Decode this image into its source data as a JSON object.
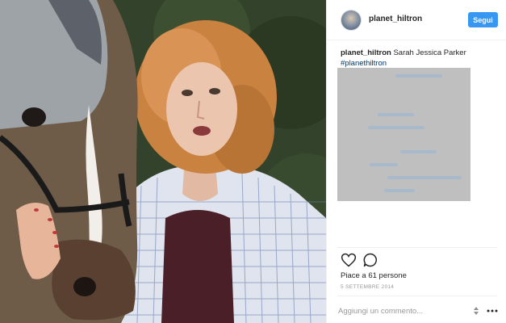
{
  "header": {
    "username": "planet_hiltron",
    "follow_label": "Segui"
  },
  "caption": {
    "user": "planet_hiltron",
    "text": "Sarah Jessica Parker",
    "hashtag": "#planethiltron"
  },
  "post": {
    "likes_text": "Piace a 61 persone",
    "date": "5 SETTEMBRE 2014"
  },
  "comment": {
    "placeholder": "Aggiungi un commento..."
  },
  "colors": {
    "follow_button": "#3897f0",
    "hashtag": "#003569",
    "censored_box": "#bfbfbf"
  },
  "icons": {
    "like": "heart-icon",
    "comment": "comment-bubble-icon",
    "more": "more-options-icon"
  }
}
